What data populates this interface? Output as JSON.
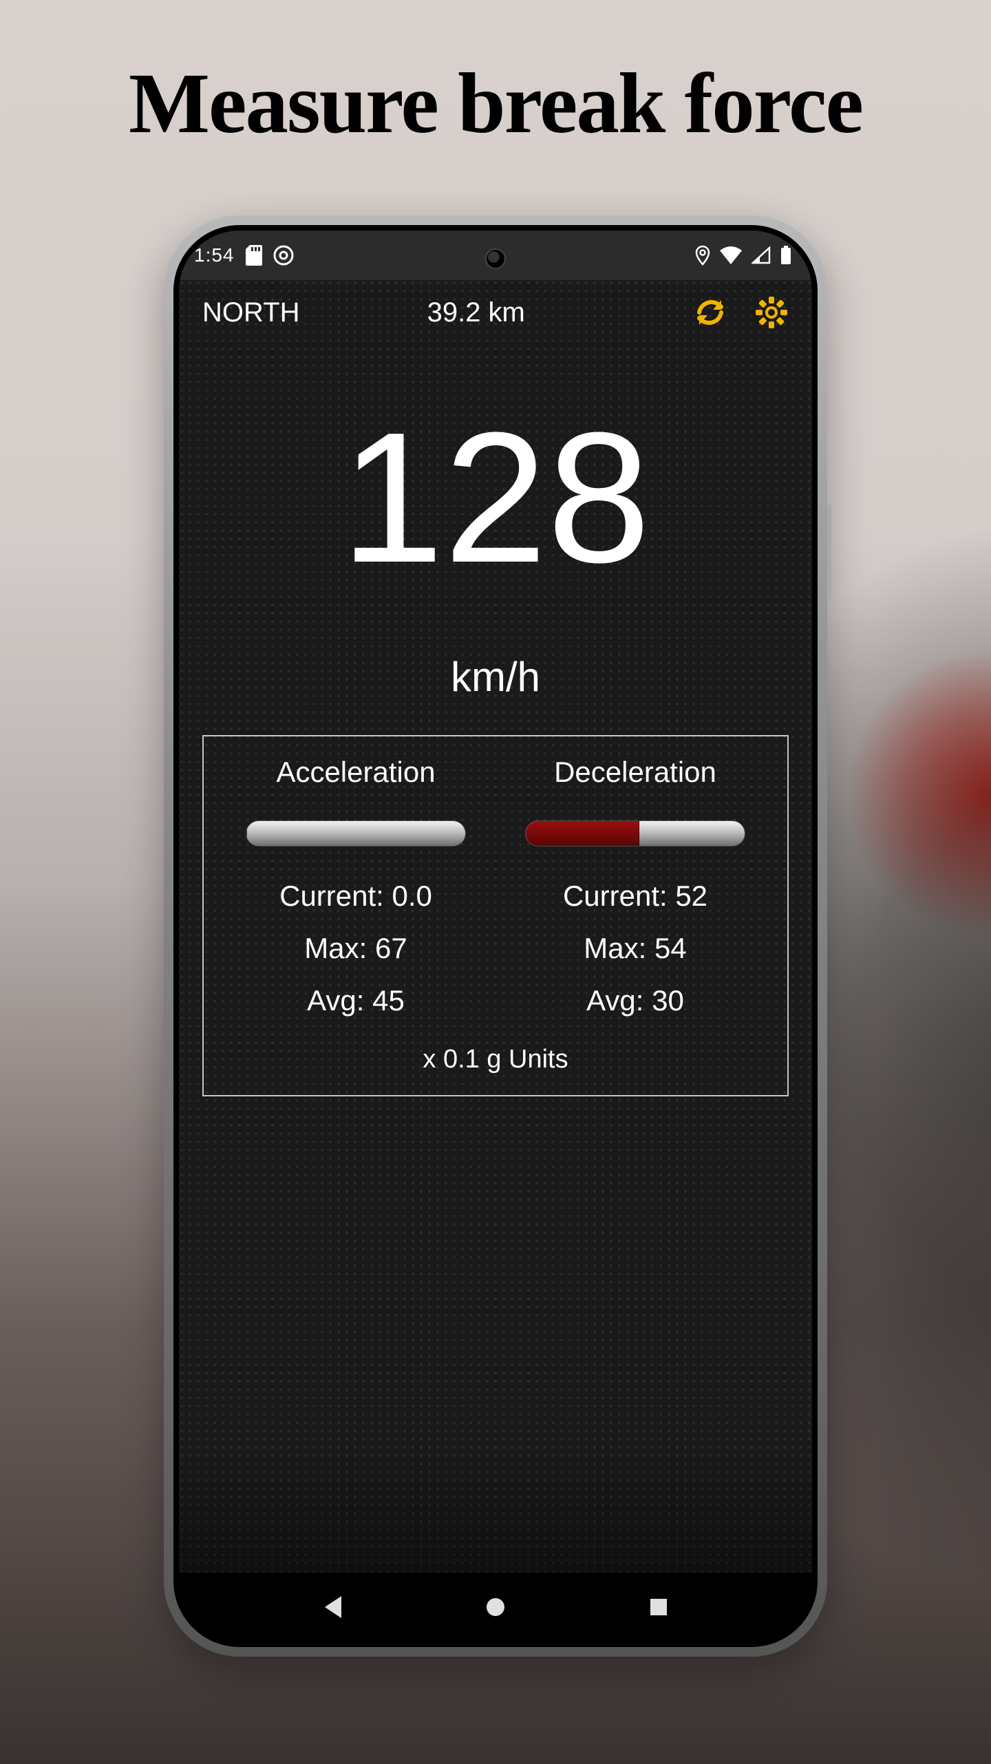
{
  "page": {
    "title": "Measure break force"
  },
  "status_bar": {
    "time": "1:54",
    "icons_left": [
      "sd-card-icon",
      "rotation-lock-icon"
    ],
    "icons_right": [
      "location-icon",
      "wifi-icon",
      "signal-icon",
      "battery-icon"
    ]
  },
  "header": {
    "direction": "NORTH",
    "distance": "39.2 km",
    "refresh_icon": "refresh-icon",
    "settings_icon": "settings-icon",
    "accent_color": "#f0b400"
  },
  "speed": {
    "value": "128",
    "unit": "km/h"
  },
  "metrics": {
    "acceleration": {
      "title": "Acceleration",
      "bar_fill_pct": 0,
      "current_label": "Current:",
      "current_value": "0.0",
      "max_label": "Max:",
      "max_value": "67",
      "avg_label": "Avg:",
      "avg_value": "45"
    },
    "deceleration": {
      "title": "Deceleration",
      "bar_fill_pct": 52,
      "current_label": "Current:",
      "current_value": "52",
      "max_label": "Max:",
      "max_value": "54",
      "avg_label": "Avg:",
      "avg_value": "30"
    },
    "units_note": "x 0.1 g Units"
  },
  "nav": {
    "back": "back",
    "home": "home",
    "recent": "recent"
  }
}
